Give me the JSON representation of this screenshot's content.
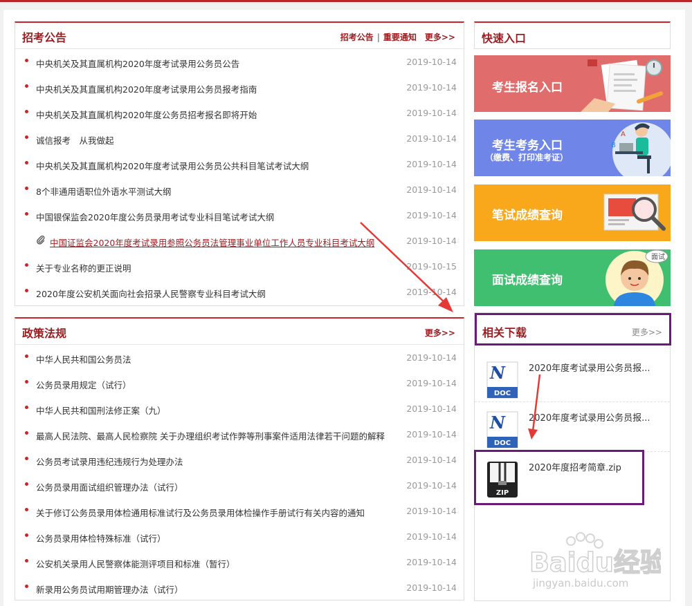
{
  "notices": {
    "title": "招考公告",
    "links": [
      "招考公告",
      "重要通知"
    ],
    "more": "更多>>",
    "items": [
      {
        "text": "中央机关及其直属机构2020年度考试录用公务员公告",
        "date": "2019-10-14"
      },
      {
        "text": "中央机关及其直属机构2020年度考试录用公务员报考指南",
        "date": "2019-10-14"
      },
      {
        "text": "中央机关及其直属机构2020年度公务员招考报名即将开始",
        "date": "2019-10-14"
      },
      {
        "text": "诚信报考　从我做起",
        "date": "2019-10-14"
      },
      {
        "text": "中央机关及其直属机构2020年度考试录用公务员公共科目笔试考试大纲",
        "date": "2019-10-14"
      },
      {
        "text": "8个非通用语职位外语水平测试大纲",
        "date": "2019-10-14"
      },
      {
        "text": "中国银保监会2020年度公务员录用考试专业科目笔试考试大纲",
        "date": "2019-10-14"
      },
      {
        "text": "中国证监会2020年度考试录用参照公务员法管理事业单位工作人员专业科目考试大纲",
        "date": "2019-10-14"
      },
      {
        "text": "关于专业名称的更正说明",
        "date": "2019-10-15"
      },
      {
        "text": "2020年度公安机关面向社会招录人民警察专业科目考试大纲",
        "date": "2019-10-14"
      }
    ]
  },
  "policy": {
    "title": "政策法规",
    "more": "更多>>",
    "items": [
      {
        "text": "中华人民共和国公务员法",
        "date": "2019-10-14"
      },
      {
        "text": "公务员录用规定（试行）",
        "date": "2019-10-14"
      },
      {
        "text": "中华人民共和国刑法修正案（九）",
        "date": "2019-10-14"
      },
      {
        "text": "最高人民法院、最高人民检察院 关于办理组织考试作弊等刑事案件适用法律若干问题的解释",
        "date": "2019-10-14"
      },
      {
        "text": "公务员考试录用违纪违规行为处理办法",
        "date": "2019-10-14"
      },
      {
        "text": "公务员录用面试组织管理办法（试行）",
        "date": "2019-10-14"
      },
      {
        "text": "关于修订公务员录用体检通用标准试行及公务员录用体检操作手册试行有关内容的通知",
        "date": "2019-10-14"
      },
      {
        "text": "公务员录用体检特殊标准（试行）",
        "date": "2019-10-14"
      },
      {
        "text": "公安机关录用人民警察体能测评项目和标准（暂行）",
        "date": "2019-10-14"
      },
      {
        "text": "新录用公务员试用期管理办法（试行）",
        "date": "2019-10-14"
      }
    ]
  },
  "quick": {
    "title": "快速入口",
    "entries": [
      {
        "label": "考生报名入口",
        "color": "#e06c6c"
      },
      {
        "label": "考生考务入口",
        "sub": "（缴费、打印准考证）",
        "color": "#6f86e8"
      },
      {
        "label": "笔试成绩查询",
        "color": "#f9a81b"
      },
      {
        "label": "面试成绩查询",
        "color": "#3fbf6f",
        "badge": "面试"
      }
    ]
  },
  "downloads": {
    "title": "相关下载",
    "more": "更多>>",
    "items": [
      {
        "name": "2020年度考试录用公务员报...",
        "type": "DOC"
      },
      {
        "name": "2020年度考试录用公务员报...",
        "type": "DOC"
      },
      {
        "name": "2020年度招考简章.zip",
        "type": "ZIP"
      }
    ]
  },
  "watermark": {
    "brand": "Baidu经验",
    "url": "jingyan.baidu.com"
  },
  "colors": {
    "accent": "#c8262c",
    "title": "#9e1b1f",
    "highlight": "#6a1b78",
    "annotation": "#e53935"
  }
}
